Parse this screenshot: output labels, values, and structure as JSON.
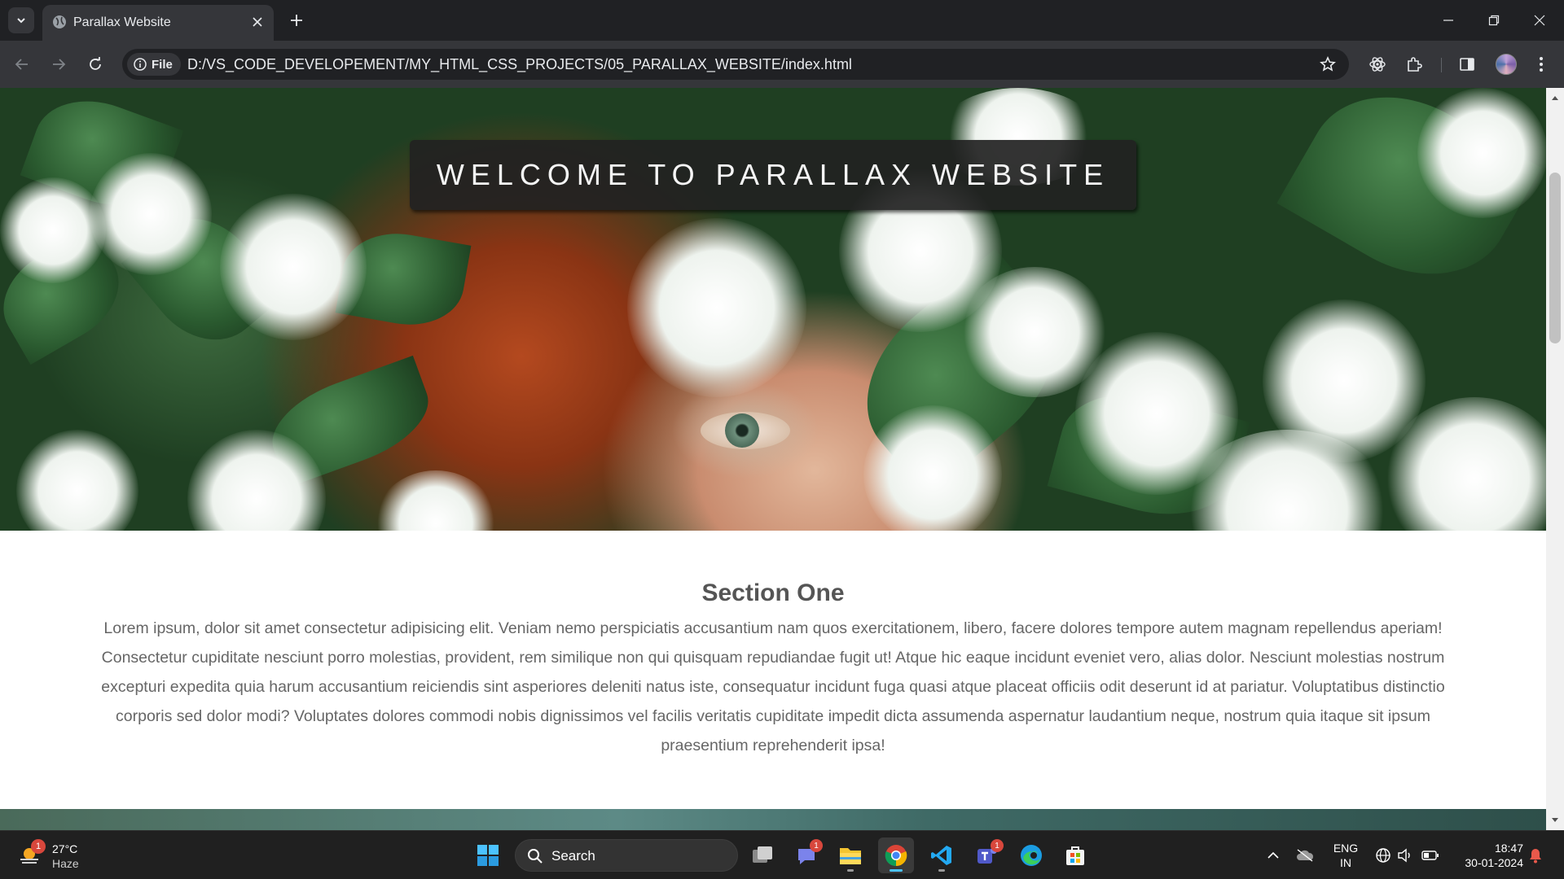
{
  "browser": {
    "tab_title": "Parallax Website",
    "file_chip": "File",
    "url": "D:/VS_CODE_DEVELOPEMENT/MY_HTML_CSS_PROJECTS/05_PARALLAX_WEBSITE/index.html"
  },
  "page": {
    "hero_title": "WELCOME TO PARALLAX WEBSITE",
    "section_heading": "Section One",
    "section_text": "Lorem ipsum, dolor sit amet consectetur adipisicing elit. Veniam nemo perspiciatis accusantium nam quos exercitationem, libero, facere dolores tempore autem magnam repellendus aperiam! Consectetur cupiditate nesciunt porro molestias, provident, rem similique non qui quisquam repudiandae fugit ut! Atque hic eaque incidunt eveniet vero, alias dolor. Nesciunt molestias nostrum excepturi expedita quia harum accusantium reiciendis sint asperiores deleniti natus iste, consequatur incidunt fuga quasi atque placeat officiis odit deserunt id at pariatur. Voluptatibus distinctio corporis sed dolor modi? Voluptates dolores commodi nobis dignissimos vel facilis veritatis cupiditate impedit dicta assumenda aspernatur laudantium neque, nostrum quia itaque sit ipsum praesentium reprehenderit ipsa!"
  },
  "taskbar": {
    "weather_temp": "27°C",
    "weather_cond": "Haze",
    "weather_badge": "1",
    "search_label": "Search",
    "teams_badge": "1",
    "teams2_badge": "1",
    "lang_line1": "ENG",
    "lang_line2": "IN",
    "time": "18:47",
    "date": "30-01-2024"
  },
  "colors": {
    "tab_bg": "#35363a",
    "frame_bg": "#202124",
    "hero_title_bg": "#222222",
    "heading": "#555555",
    "body_text": "#666666",
    "taskbar_bg": "#202020",
    "accent": "#4cc2ff"
  },
  "icons": [
    "tab-search-icon",
    "globe-icon",
    "close-icon",
    "plus-icon",
    "minimize-icon",
    "restore-icon",
    "back-icon",
    "forward-icon",
    "reload-icon",
    "info-icon",
    "star-icon",
    "extension-icon",
    "puzzle-icon",
    "sidepanel-icon",
    "menu-icon",
    "windows-icon",
    "search-icon",
    "chrome-icon",
    "vscode-icon",
    "edge-icon",
    "store-icon",
    "folder-icon",
    "wifi-icon",
    "volume-icon",
    "battery-icon",
    "bell-icon"
  ]
}
